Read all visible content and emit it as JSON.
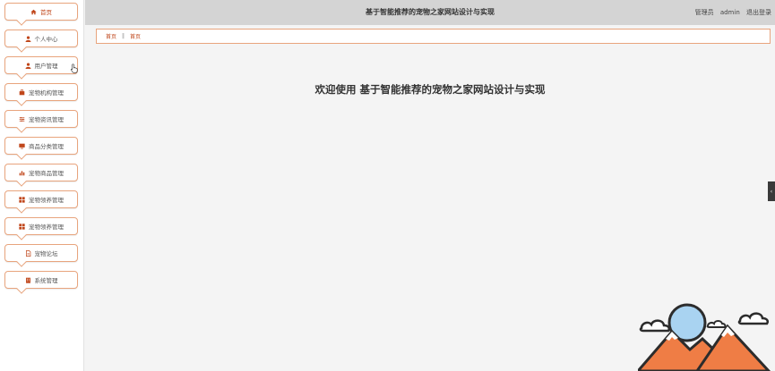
{
  "app": {
    "title": "基于智能推荐的宠物之家网站设计与实现",
    "user_role": "管理员",
    "user_name": "admin",
    "logout": "退出登录"
  },
  "sidebar": {
    "items": [
      {
        "label": "首页",
        "icon": "home-icon"
      },
      {
        "label": "个人中心",
        "icon": "user-icon"
      },
      {
        "label": "用户管理",
        "icon": "user-icon"
      },
      {
        "label": "宠物机构管理",
        "icon": "briefcase-icon"
      },
      {
        "label": "宠物资讯管理",
        "icon": "sliders-icon"
      },
      {
        "label": "商品分类管理",
        "icon": "monitor-icon"
      },
      {
        "label": "宠物商品管理",
        "icon": "bar-chart-icon"
      },
      {
        "label": "宠物领养管理",
        "icon": "grid-icon"
      },
      {
        "label": "宠物领养管理",
        "icon": "grid-icon"
      },
      {
        "label": "宠物论坛",
        "icon": "document-icon"
      },
      {
        "label": "系统管理",
        "icon": "building-icon"
      }
    ]
  },
  "breadcrumb": {
    "items": [
      "首页",
      "首页"
    ]
  },
  "main": {
    "welcome": "欢迎使用 基于智能推荐的宠物之家网站设计与实现"
  },
  "colors": {
    "accent": "#e8a47d",
    "accent_text": "#c0461a",
    "topbar_bg": "#d4d4d4",
    "page_bg": "#f4f4f4"
  }
}
